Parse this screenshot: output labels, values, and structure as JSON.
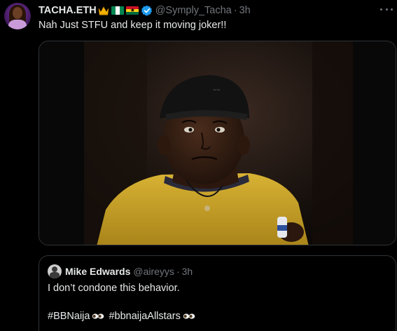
{
  "tweet": {
    "display_name": "TACHA.ETH",
    "handle": "@Symply_Tacha",
    "separator": "·",
    "time": "3h",
    "text": "Nah Just STFU and keep it moving joker!!",
    "icons": {
      "crown": "crown-emoji-icon",
      "flag_1": "nigeria-flag-icon",
      "flag_2": "ghana-flag-icon",
      "verified": "verified-badge-icon",
      "more": "more-options-icon"
    },
    "colors": {
      "background": "#000000",
      "text": "#e7e9ea",
      "secondary": "#71767b",
      "verified": "#1d9bf0",
      "border": "#2f3336"
    }
  },
  "quote": {
    "display_name": "Mike Edwards",
    "handle": "@aireyys",
    "separator": "·",
    "time": "3h",
    "text": "I don’t condone this behavior.",
    "hashtags": [
      {
        "text": "#BBNaija",
        "icon": "eyes-emoji-icon"
      },
      {
        "text": "#bbnaijaAllstars",
        "icon": "eyes-emoji-icon"
      }
    ]
  }
}
